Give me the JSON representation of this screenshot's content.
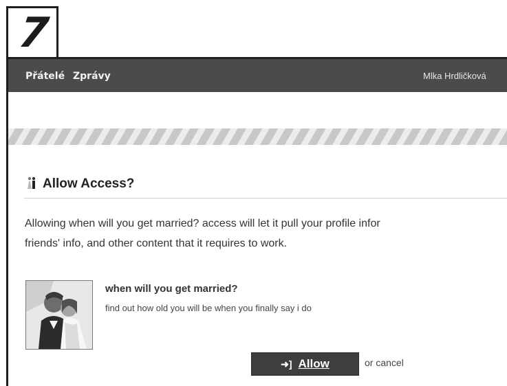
{
  "step": {
    "number": "7"
  },
  "topbar": {
    "nav_friends": "Přátelé",
    "nav_messages": "Zprávy",
    "user_name": "Mlka Hrdličková"
  },
  "dialog": {
    "title": "Allow Access?",
    "description_line1": "Allowing when will you get married? access will let it pull your profile infor",
    "description_line2": "friends' info, and other content that it requires to work.",
    "app_name": "when will you get married?",
    "app_description": "find out how old you will be when you finally say i do",
    "allow_label": "Allow",
    "allow_icon": "login-arrow-icon",
    "or_text": "or",
    "cancel_label": "cancel"
  },
  "colors": {
    "topbar": "#4b4b4b",
    "button": "#3e3e3e",
    "frame": "#1f1f1f"
  }
}
